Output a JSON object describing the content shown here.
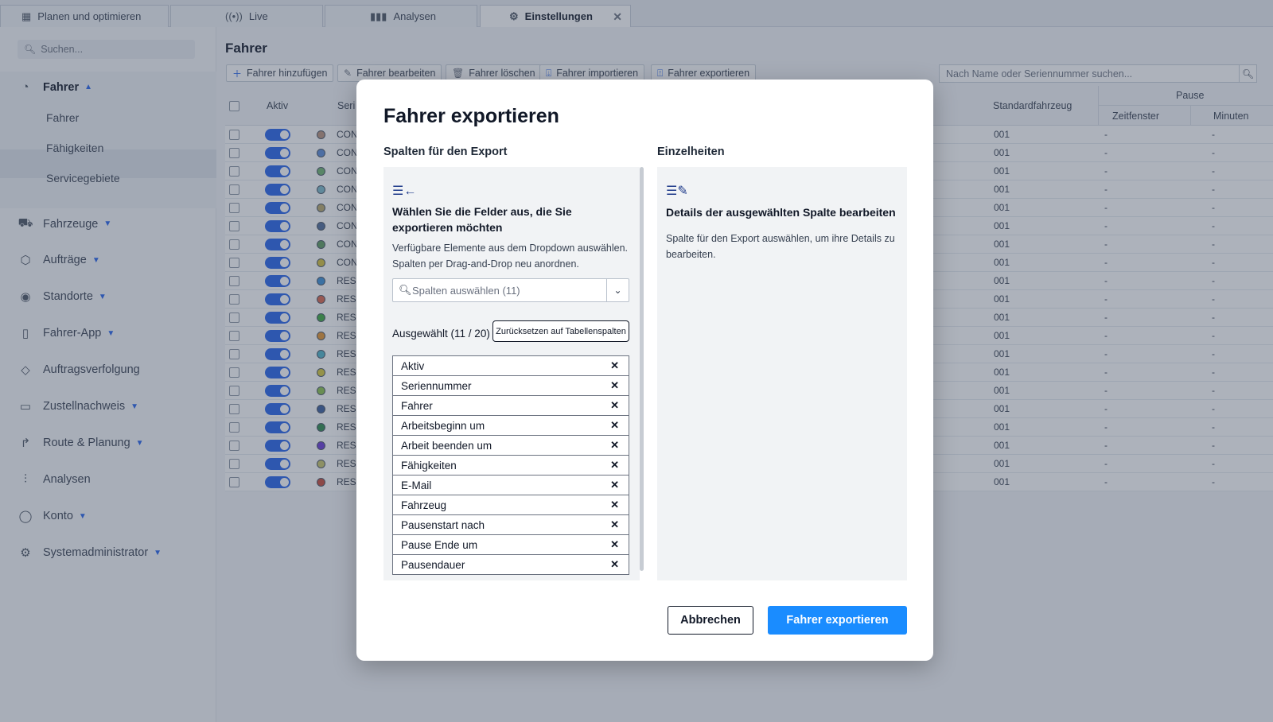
{
  "tabs": [
    {
      "label": "Planen und optimieren",
      "icon": "calendar-icon"
    },
    {
      "label": "Live",
      "icon": "broadcast-icon"
    },
    {
      "label": "Analysen",
      "icon": "bar-chart-icon"
    },
    {
      "label": "Einstellungen",
      "icon": "gear-icon",
      "active": true
    }
  ],
  "sidebar": {
    "search_placeholder": "Suchen...",
    "fahrer": {
      "label": "Fahrer",
      "subitems": [
        "Fahrer",
        "Fähigkeiten",
        "Servicegebiete"
      ]
    },
    "items": [
      {
        "label": "Fahrzeuge",
        "icon": "truck-icon"
      },
      {
        "label": "Aufträge",
        "icon": "package-icon"
      },
      {
        "label": "Standorte",
        "icon": "map-pin-icon"
      },
      {
        "label": "Fahrer-App",
        "icon": "phone-icon"
      },
      {
        "label": "Auftragsverfolgung",
        "icon": "tag-icon"
      },
      {
        "label": "Zustellnachweis",
        "icon": "clipboard-icon"
      },
      {
        "label": "Route & Planung",
        "icon": "route-icon"
      },
      {
        "label": "Analysen",
        "icon": "bar-chart-icon"
      },
      {
        "label": "Konto",
        "icon": "user-icon"
      },
      {
        "label": "Systemadministrator",
        "icon": "gear-icon"
      }
    ]
  },
  "main": {
    "title": "Fahrer",
    "toolbar": {
      "add": "Fahrer hinzufügen",
      "edit": "Fahrer bearbeiten",
      "delete": "Fahrer löschen",
      "import": "Fahrer importieren",
      "export": "Fahrer exportieren",
      "search_placeholder": "Nach Name oder Seriennummer suchen..."
    },
    "table": {
      "headers": {
        "active": "Aktiv",
        "serial": "Seri",
        "vehicle": "Standardfahrzeug",
        "pause": "Pause",
        "window": "Zeitfenster",
        "minutes": "Minuten"
      },
      "rows": [
        {
          "serial": "CON",
          "dot": "#b8927a",
          "vehicle": "001",
          "window": "-",
          "minutes": "-"
        },
        {
          "serial": "CON",
          "dot": "#5b8bd6",
          "vehicle": "001",
          "window": "-",
          "minutes": "-"
        },
        {
          "serial": "CON",
          "dot": "#6fb36f",
          "vehicle": "001",
          "window": "-",
          "minutes": "-"
        },
        {
          "serial": "CON",
          "dot": "#7ab8c9",
          "vehicle": "001",
          "window": "-",
          "minutes": "-"
        },
        {
          "serial": "CON",
          "dot": "#b8a86a",
          "vehicle": "001",
          "window": "-",
          "minutes": "-"
        },
        {
          "serial": "CON",
          "dot": "#4e6b99",
          "vehicle": "001",
          "window": "-",
          "minutes": "-"
        },
        {
          "serial": "CON",
          "dot": "#5e9a5e",
          "vehicle": "001",
          "window": "-",
          "minutes": "-"
        },
        {
          "serial": "CON",
          "dot": "#d4c03a",
          "vehicle": "001",
          "window": "-",
          "minutes": "-"
        },
        {
          "serial": "RES",
          "dot": "#3b8fd6",
          "vehicle": "001",
          "window": "-",
          "minutes": "-"
        },
        {
          "serial": "RES",
          "dot": "#d9644a",
          "vehicle": "001",
          "window": "-",
          "minutes": "-"
        },
        {
          "serial": "RES",
          "dot": "#3daa3d",
          "vehicle": "001",
          "window": "-",
          "minutes": "-"
        },
        {
          "serial": "RES",
          "dot": "#e6942e",
          "vehicle": "001",
          "window": "-",
          "minutes": "-"
        },
        {
          "serial": "RES",
          "dot": "#4fb3c9",
          "vehicle": "001",
          "window": "-",
          "minutes": "-"
        },
        {
          "serial": "RES",
          "dot": "#d6c93a",
          "vehicle": "001",
          "window": "-",
          "minutes": "-"
        },
        {
          "serial": "RES",
          "dot": "#8ac24a",
          "vehicle": "001",
          "window": "-",
          "minutes": "-"
        },
        {
          "serial": "RES",
          "dot": "#3a5e9e",
          "vehicle": "001",
          "window": "-",
          "minutes": "-"
        },
        {
          "serial": "RES",
          "dot": "#2e8a4a",
          "vehicle": "001",
          "window": "-",
          "minutes": "-"
        },
        {
          "serial": "RES",
          "dot": "#6a3ad6",
          "vehicle": "001",
          "window": "-",
          "minutes": "-"
        },
        {
          "serial": "RES",
          "dot": "#c9c46a",
          "vehicle": "001",
          "window": "-",
          "minutes": "-"
        },
        {
          "serial": "RES",
          "dot": "#c94a3a",
          "vehicle": "001",
          "window": "-",
          "minutes": "-"
        }
      ]
    }
  },
  "modal": {
    "title": "Fahrer exportieren",
    "left_label": "Spalten für den Export",
    "right_label": "Einzelheiten",
    "left_heading": "Wählen Sie die Felder aus, die Sie exportieren möchten",
    "left_desc": "Verfügbare Elemente aus dem Dropdown auswählen. Spalten per Drag-and-Drop neu anordnen.",
    "select_placeholder": "Spalten auswählen (11)",
    "selected_count": "Ausgewählt (11 / 20)",
    "reset_label": "Zurücksetzen auf Tabellenspalten",
    "columns": [
      "Aktiv",
      "Seriennummer",
      "Fahrer",
      "Arbeitsbeginn um",
      "Arbeit beenden um",
      "Fähigkeiten",
      "E-Mail",
      "Fahrzeug",
      "Pausenstart nach",
      "Pause Ende um",
      "Pausendauer"
    ],
    "right_heading": "Details der ausgewählten Spalte bearbeiten",
    "right_desc": "Spalte für den Export auswählen, um ihre Details zu bearbeiten.",
    "cancel_label": "Abbrechen",
    "export_label": "Fahrer exportieren"
  },
  "colors": {
    "primary": "#1a8cff",
    "toggle": "#2563eb",
    "overlay": "rgba(60,72,92,0.42)"
  }
}
